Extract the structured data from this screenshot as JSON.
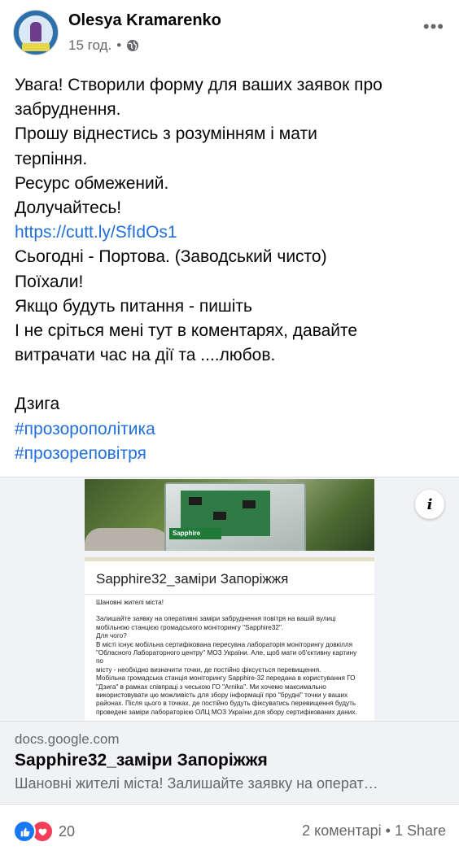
{
  "post": {
    "author": "Olesya Kramarenko",
    "time": "15 год.",
    "separator": "•",
    "audience_icon": "globe-icon",
    "more_icon": "more-icon",
    "more_label": "•••",
    "lines": [
      "Увага! Створили форму для ваших заявок про",
      "забруднення.",
      "Прошу віднестись з розумінням і мати",
      "терпіння.",
      "Ресурс обмежений.",
      "Долучайтесь!",
      "https://cutt.ly/SfIdOs1",
      "Сьогодні - Портова. (Заводський чисто)",
      "Поїхали!",
      "Якщо будуть питання - пишіть",
      "І не сріться мені тут в коментарях, давайте",
      "витрачати час на дії та ....любов.",
      "",
      "Дзига",
      "#прозорополітика",
      "#прозореповітря"
    ],
    "link_line_indices": [
      6,
      14,
      15
    ]
  },
  "preview": {
    "info_label": "i",
    "photo_label": "Sapphire",
    "form_title": "Sapphire32_заміри Запоріжжя",
    "form_lines": [
      "Шановні жителі міста!",
      "",
      "Залишайте заявку на оперативні заміри забруднення повітря на вашій вулиці",
      "мобільною станцією громадського моніторингу \"Sapphire32\".",
      "Для чого?",
      "В місті існує мобільна сертифікована пересувна лабораторія моніторингу довкілля",
      "\"Обласного Лабораторного центру\" МОЗ України. Але, щоб мати об'єктивну картину по",
      "місту - необхідно визначити точки, де постійно фіксується перевищення.",
      "Мобільна громадська станція моніторингу Sapphire-32 передана в користування ГО",
      "\"Дзига\" в рамках співпраці з чеською ГО \"Arnika\". Ми хочемо максимально",
      "використовувати цю можливість для збору інформації про \"брудні\" точки у ваших",
      "районах. Після цього в точках, де постійно будуть фіксуватись перевищення будуть",
      "проведені заміри лабораторією ОЛЦ МОЗ України для збору сертифікованих даних."
    ],
    "domain": "docs.google.com",
    "title": "Sapphire32_заміри Запоріжжя",
    "description": "Шановні жителі міста! Залишайте заявку на операт…"
  },
  "footer": {
    "reaction_count": "20",
    "stats": "2 коментарі • 1 Share"
  },
  "colors": {
    "link": "#216fdb",
    "like": "#1877f2",
    "love": "#f33e58",
    "muted": "#65676b"
  }
}
